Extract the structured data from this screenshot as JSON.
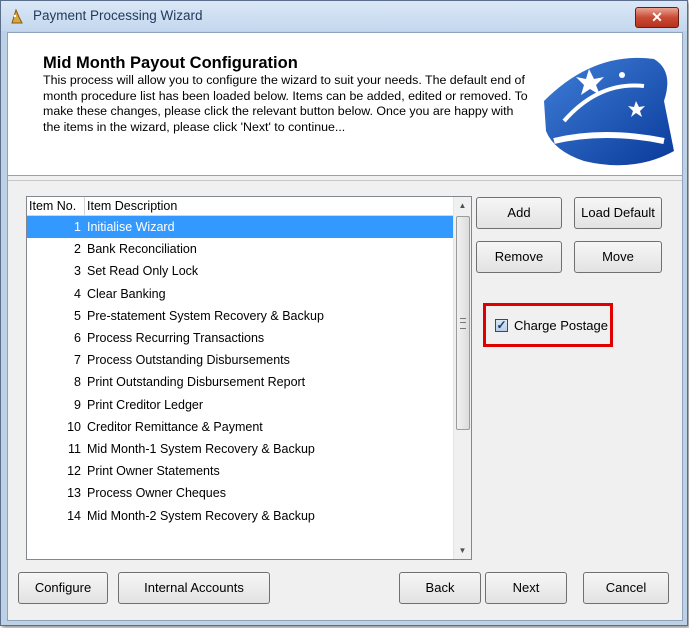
{
  "window": {
    "title": "Payment Processing Wizard",
    "close_glyph": "✕",
    "icon": "wizard-app-icon"
  },
  "header": {
    "title": "Mid Month Payout Configuration",
    "description": "This process will allow you to configure the wizard to suit your needs. The default end of month procedure list has been loaded below. Items can be added, edited or removed. To make these changes, please click the relevant button below. Once you are happy with the items in the wizard, please click 'Next' to continue...",
    "logo": "wizard-hat-logo"
  },
  "list": {
    "columns": [
      "Item No.",
      "Item Description"
    ],
    "selected_index": 0,
    "items": [
      {
        "no": "1",
        "desc": "Initialise Wizard"
      },
      {
        "no": "2",
        "desc": "Bank Reconciliation"
      },
      {
        "no": "3",
        "desc": "Set Read Only Lock"
      },
      {
        "no": "4",
        "desc": "Clear Banking"
      },
      {
        "no": "5",
        "desc": "Pre-statement System Recovery & Backup"
      },
      {
        "no": "6",
        "desc": "Process Recurring Transactions"
      },
      {
        "no": "7",
        "desc": "Process Outstanding Disbursements"
      },
      {
        "no": "8",
        "desc": "Print Outstanding Disbursement Report"
      },
      {
        "no": "9",
        "desc": "Print Creditor Ledger"
      },
      {
        "no": "10",
        "desc": "Creditor Remittance & Payment"
      },
      {
        "no": "11",
        "desc": "Mid Month-1 System Recovery & Backup"
      },
      {
        "no": "12",
        "desc": "Print Owner Statements"
      },
      {
        "no": "13",
        "desc": "Process Owner Cheques"
      },
      {
        "no": "14",
        "desc": "Mid Month-2 System Recovery & Backup"
      }
    ]
  },
  "side_buttons": {
    "add": "Add",
    "load_default": "Load Default",
    "remove": "Remove",
    "move": "Move"
  },
  "charge_postage": {
    "label": "Charge Postage",
    "checked": true,
    "check_glyph": "✓"
  },
  "footer": {
    "configure": "Configure",
    "internal_accounts": "Internal Accounts",
    "back": "Back",
    "next": "Next",
    "cancel": "Cancel"
  },
  "colors": {
    "selection": "#3399ff",
    "highlight_border": "#e00000",
    "title_text": "#1e395b"
  }
}
